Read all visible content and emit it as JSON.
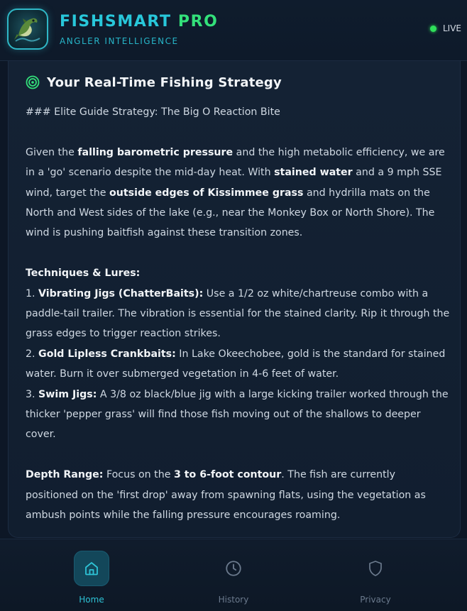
{
  "app": {
    "brand_part1": "FISHSMART",
    "brand_part2": "PRO",
    "tagline": "ANGLER INTELLIGENCE",
    "status": "LIVE",
    "logo_icon": "bass-fish-logo"
  },
  "colors": {
    "accent_cyan": "#28c7da",
    "accent_green": "#33e07a",
    "live_dot": "#2fe05a",
    "background": "#0d1726"
  },
  "strategy": {
    "title": "Your Real-Time Fishing Strategy",
    "icon": "target-icon",
    "heading_line": "### Elite Guide Strategy: The Big O Reaction Bite",
    "intro": {
      "t1": "Given the ",
      "b1": "falling barometric pressure",
      "t2": " and the high metabolic efficiency, we are in a 'go' scenario despite the mid-day heat. With ",
      "b2": "stained water",
      "t3": " and a 9 mph SSE wind, target the ",
      "b3": "outside edges of Kissimmee grass",
      "t4": " and hydrilla mats on the North and West sides of the lake (e.g., near the Monkey Box or North Shore). The wind is pushing baitfish against these transition zones."
    },
    "techniques_heading": "Techniques & Lures:",
    "techniques": [
      {
        "num": "1. ",
        "name": "Vibrating Jigs (ChatterBaits):",
        "text": " Use a 1/2 oz white/chartreuse combo with a paddle-tail trailer. The vibration is essential for the stained clarity. Rip it through the grass edges to trigger reaction strikes."
      },
      {
        "num": "2. ",
        "name": "Gold Lipless Crankbaits:",
        "text": " In Lake Okeechobee, gold is the standard for stained water. Burn it over submerged vegetation in 4-6 feet of water."
      },
      {
        "num": "3. ",
        "name": "Swim Jigs:",
        "text": " A 3/8 oz black/blue jig with a large kicking trailer worked through the thicker 'pepper grass' will find those fish moving out of the shallows to deeper cover."
      }
    ],
    "depth": {
      "b1": "Depth Range:",
      "t1": " Focus on the ",
      "b2": "3 to 6-foot contour",
      "t2": ". The fish are currently positioned on the 'first drop' away from spawning flats, using the vegetation as ambush points while the falling pressure encourages roaming."
    }
  },
  "nav": {
    "items": [
      {
        "label": "Home",
        "icon": "home-icon",
        "active": true
      },
      {
        "label": "History",
        "icon": "clock-icon",
        "active": false
      },
      {
        "label": "Privacy",
        "icon": "shield-icon",
        "active": false
      }
    ]
  }
}
